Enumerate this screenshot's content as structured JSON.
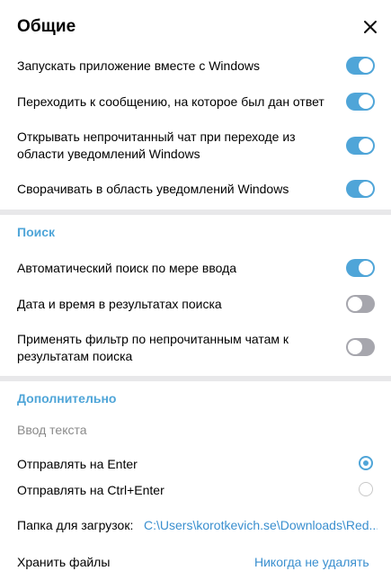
{
  "header": {
    "title": "Общие"
  },
  "general": {
    "items": [
      {
        "label": "Запускать приложение вместе с Windows",
        "state": "on"
      },
      {
        "label": "Переходить к сообщению, на которое был дан ответ",
        "state": "on"
      },
      {
        "label": "Открывать непрочитанный чат при переходе из области уведомлений Windows",
        "state": "on"
      },
      {
        "label": "Сворачивать в область уведомлений Windows",
        "state": "on"
      }
    ]
  },
  "search": {
    "title": "Поиск",
    "items": [
      {
        "label": "Автоматический поиск по мере ввода",
        "state": "on"
      },
      {
        "label": "Дата и время в результатах поиска",
        "state": "off"
      },
      {
        "label": "Применять фильтр по непрочитанным чатам к результатам поиска",
        "state": "off"
      }
    ]
  },
  "advanced": {
    "title": "Дополнительно",
    "input_title": "Ввод текста",
    "send_options": [
      {
        "label": "Отправлять на Enter",
        "selected": true
      },
      {
        "label": "Отправлять на Ctrl+Enter",
        "selected": false
      }
    ],
    "download_folder_label": "Папка для загрузок:",
    "download_folder_value": "C:\\Users\\korotkevich.se\\Downloads\\Red...",
    "keep_files_label": "Хранить файлы",
    "keep_files_value": "Никогда не удалять"
  },
  "colors": {
    "accent": "#4fa5d8",
    "toggle_off": "#a6a6ad",
    "divider": "#e8e8ea"
  }
}
